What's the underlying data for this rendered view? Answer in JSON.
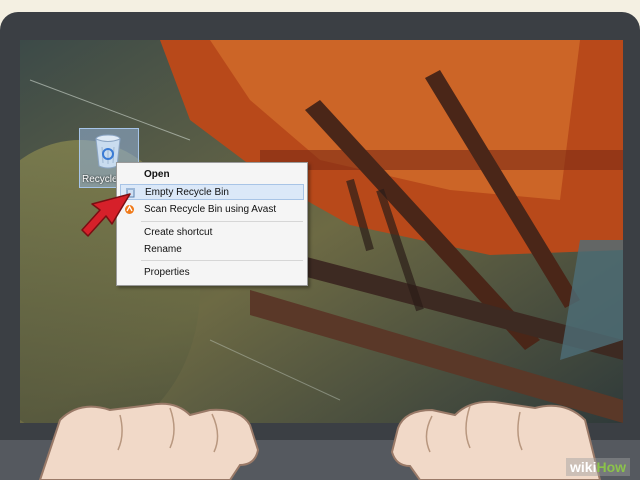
{
  "desktop": {
    "icon_label": "Recycle Bin"
  },
  "context_menu": {
    "items": [
      {
        "label": "Open"
      },
      {
        "label": "Empty Recycle Bin"
      },
      {
        "label": "Scan Recycle Bin using Avast"
      },
      {
        "label": "Create shortcut"
      },
      {
        "label": "Rename"
      },
      {
        "label": "Properties"
      }
    ],
    "highlighted_item": "Empty Recycle Bin"
  },
  "watermark": {
    "wiki": "wiki",
    "how": "How"
  },
  "colors": {
    "arrow": "#d6202a",
    "menu_highlight": "#dbe8f8",
    "wallpaper_orange": "#c0501c",
    "bezel": "#3b3f44"
  }
}
